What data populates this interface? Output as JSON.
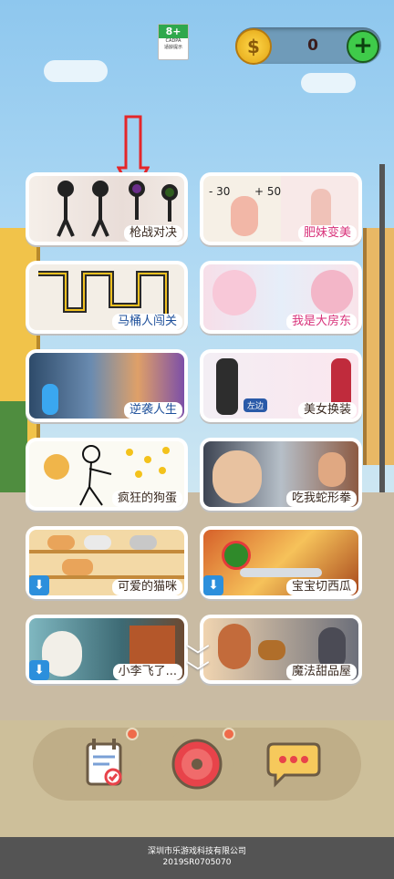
{
  "header": {
    "age_rating": "8+",
    "age_org": "CADPA",
    "age_note": "适龄提示",
    "coin_count": "0",
    "coin_symbol": "$",
    "add_symbol": "+"
  },
  "games": [
    {
      "label": "枪战对决",
      "download": false
    },
    {
      "label": "肥妹变美",
      "download": false,
      "tag_left": "- 30",
      "tag_right": "+ 50"
    },
    {
      "label": "马桶人闯关",
      "download": false
    },
    {
      "label": "我是大房东",
      "download": false
    },
    {
      "label": "逆袭人生",
      "download": false
    },
    {
      "label": "美女换装",
      "download": false,
      "tag_left": "左边"
    },
    {
      "label": "疯狂的狗蛋",
      "download": false
    },
    {
      "label": "吃我蛇形拳",
      "download": false
    },
    {
      "label": "可爱的猫咪",
      "download": true
    },
    {
      "label": "宝宝切西瓜",
      "download": true
    },
    {
      "label": "小李飞了...",
      "download": true
    },
    {
      "label": "魔法甜品屋",
      "download": false
    }
  ],
  "footer": {
    "company": "深圳市乐游戏科技有限公司",
    "reg": "2019SR0705070"
  },
  "icons": {
    "download": "download-icon",
    "calendar": "calendar-icon",
    "record": "record-icon",
    "chat": "chat-icon"
  },
  "colors": {
    "accent_red": "#e8434a",
    "label_pink": "#d8327a",
    "coin_gold": "#ffd84a",
    "add_green": "#3fcb4a"
  }
}
